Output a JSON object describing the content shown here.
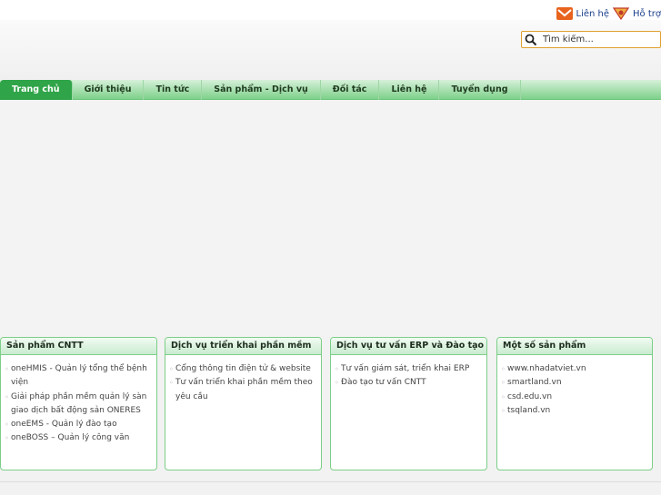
{
  "toplinks": {
    "contact": "Liên hệ",
    "support": "Hỗ trợ"
  },
  "search": {
    "placeholder": "Tìm kiếm..."
  },
  "nav": {
    "items": [
      "Trang chủ",
      "Giới thiệu",
      "Tin tức",
      "Sản phẩm - Dịch vụ",
      "Đối tác",
      "Liên hệ",
      "Tuyển dụng"
    ]
  },
  "boxes": [
    {
      "title": "Sản phẩm CNTT",
      "items": [
        "oneHMIS - Quản lý tổng thể bệnh viện",
        "Giải pháp phần mềm quản lý sàn giao dịch bất động sản ONERES",
        "oneEMS - Quản lý đào tạo",
        "oneBOSS – Quản lý công văn"
      ]
    },
    {
      "title": "Dịch vụ triển khai phần mềm",
      "items": [
        "Cổng thông tin điện tử & website",
        "Tư vấn triển khai phần mềm theo yêu cầu"
      ]
    },
    {
      "title": "Dịch vụ tư vấn ERP và Đào tạo",
      "items": [
        "Tư vấn giám sát, triển khai ERP",
        "Đào tạo tư vấn CNTT"
      ]
    },
    {
      "title": "Một số sản phẩm",
      "items": [
        "www.nhadatviet.vn",
        "smartland.vn",
        "csd.edu.vn",
        "tsqland.vn"
      ]
    }
  ],
  "colors": {
    "nav_active": "#2fa448",
    "box_border": "#7ccf88",
    "search_border": "#e0a030",
    "link": "#1a3e8c"
  }
}
